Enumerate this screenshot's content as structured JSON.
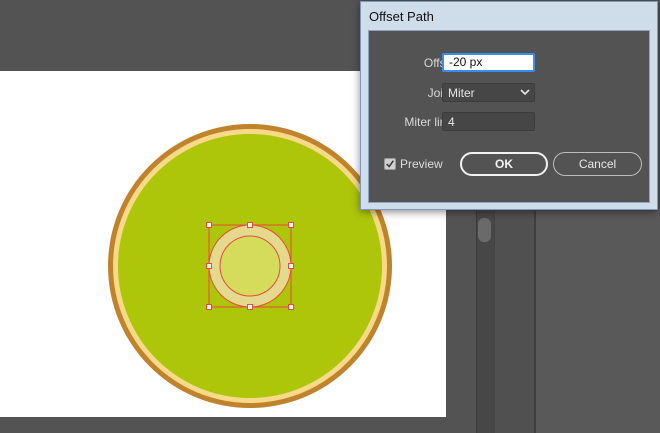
{
  "dialog": {
    "title": "Offset Path",
    "offset_label": "Offset:",
    "offset_value": "-20 px",
    "joins_label": "Joins:",
    "joins_value": "Miter",
    "miter_label": "Miter limit:",
    "miter_value": "4",
    "preview_label": "Preview",
    "preview_checked": true,
    "ok_label": "OK",
    "cancel_label": "Cancel"
  },
  "artwork": {
    "outer_rim_color": "#c0822b",
    "inner_rim_color": "#f7d98a",
    "fill_color": "#aec609",
    "center_color": "#d5dc5c",
    "center_ring_color": "#e5d98e",
    "selection_color": "#e84b3b"
  }
}
